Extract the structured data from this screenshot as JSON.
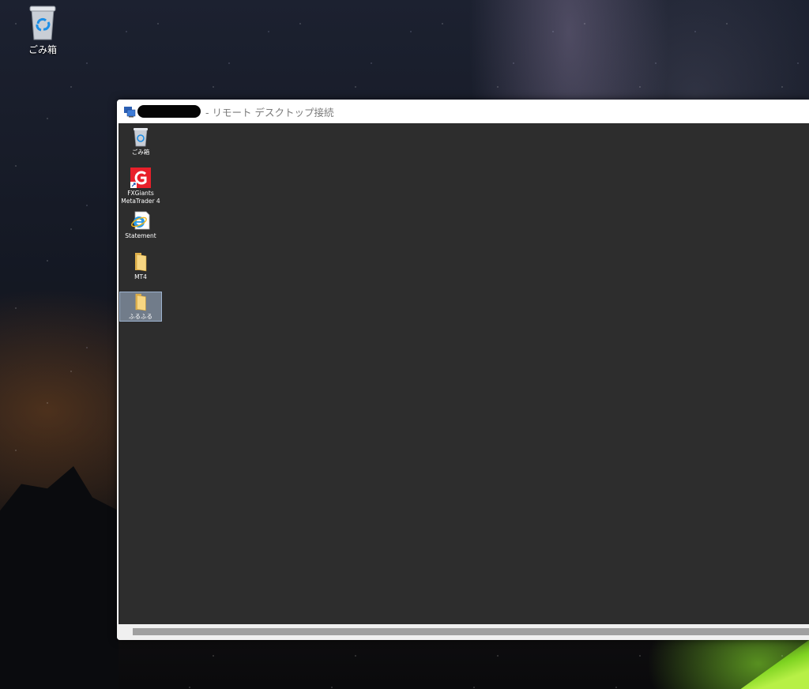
{
  "host_desktop": {
    "icons": [
      {
        "label": "ごみ箱",
        "icon": "recycle-bin-icon"
      }
    ]
  },
  "rdp_window": {
    "title_suffix": "- リモート デスクトップ接続",
    "title_redacted": true,
    "app_icon": "remote-desktop-icon",
    "remote_desktop": {
      "background": "#2d2d2d",
      "icons": [
        {
          "label_lines": [
            "ごみ箱"
          ],
          "icon": "recycle-bin-icon",
          "selected": false
        },
        {
          "label_lines": [
            "FXGiants",
            "MetaTrader 4"
          ],
          "icon": "fxgiants-mt4-icon",
          "selected": false
        },
        {
          "label_lines": [
            "Statement"
          ],
          "icon": "internet-explorer-icon",
          "selected": false
        },
        {
          "label_lines": [
            "MT4"
          ],
          "icon": "folder-icon",
          "selected": false
        },
        {
          "label_lines": [
            "ふるふる"
          ],
          "icon": "folder-icon",
          "selected": true
        }
      ]
    }
  },
  "colors": {
    "fxgiants_red": "#e8202a",
    "folder_yellow": "#f2c75c",
    "selection": "#aabed7"
  }
}
